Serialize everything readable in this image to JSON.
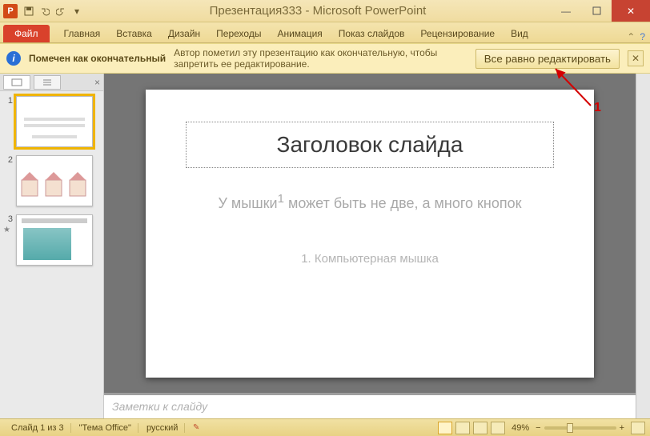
{
  "title": {
    "doc": "Презентация333",
    "sep": " - ",
    "app": "Microsoft PowerPoint"
  },
  "appicon_letter": "P",
  "ribbon": {
    "file": "Файл",
    "tabs": [
      "Главная",
      "Вставка",
      "Дизайн",
      "Переходы",
      "Анимация",
      "Показ слайдов",
      "Рецензирование",
      "Вид"
    ]
  },
  "msgbar": {
    "title": "Помечен как окончательный",
    "text": "Автор пометил эту презентацию как окончательную, чтобы запретить ее редактирование.",
    "button": "Все равно редактировать"
  },
  "thumbs": [
    {
      "n": "1",
      "selected": true,
      "star": false
    },
    {
      "n": "2",
      "selected": false,
      "star": false
    },
    {
      "n": "3",
      "selected": false,
      "star": true
    }
  ],
  "slide": {
    "title": "Заголовок слайда",
    "sub_a": "У мышки",
    "sup": "1",
    "sub_b": " может быть не две, а много кнопок",
    "foot": "1. Компьютерная мышка"
  },
  "notes_placeholder": "Заметки к слайду",
  "status": {
    "slide": "Слайд 1 из 3",
    "theme": "\"Тема Office\"",
    "lang": "русский",
    "zoom": "49%"
  },
  "annotation": {
    "num": "1"
  }
}
